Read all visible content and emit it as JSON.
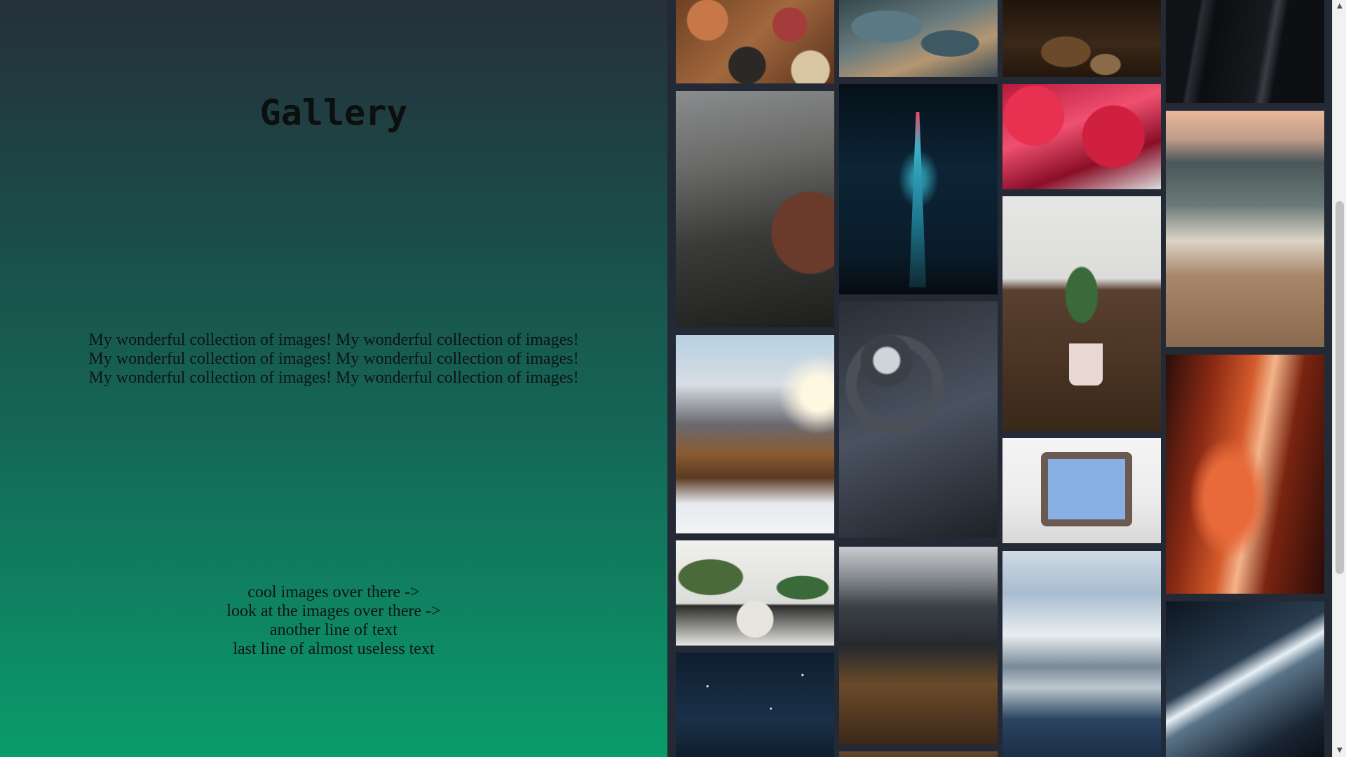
{
  "left_panel": {
    "title": "Gallery",
    "intro_lines": [
      "My wonderful collection of images! My wonderful collection of images!",
      "My wonderful collection of images! My wonderful collection of images!",
      "My wonderful collection of images! My wonderful collection of images!"
    ],
    "bottom_lines": [
      "cool images over there ->",
      "look at the images over there ->",
      "another line of text",
      "last line of almost useless text"
    ]
  },
  "gallery": {
    "columns": [
      [
        {
          "name": "food-table-photo",
          "style": "t-food"
        },
        {
          "name": "rainy-city-street-photo",
          "style": "t-rain"
        },
        {
          "name": "snowy-mountain-forest-photo",
          "style": "t-mountain"
        },
        {
          "name": "cactus-pots-photo",
          "style": "t-cactuspots"
        },
        {
          "name": "starry-sky-photo",
          "style": "t-stars"
        }
      ],
      [
        {
          "name": "aerial-coast-photo",
          "style": "t-aerial"
        },
        {
          "name": "lit-tower-night-photo",
          "style": "t-tower"
        },
        {
          "name": "spiral-staircase-photo",
          "style": "t-spiral"
        },
        {
          "name": "pier-stairs-sea-photo",
          "style": "t-pier"
        },
        {
          "name": "partial-photo",
          "style": "t-strip"
        }
      ],
      [
        {
          "name": "autumn-leaves-photo",
          "style": "t-leaves"
        },
        {
          "name": "red-tree-photo",
          "style": "t-redtree"
        },
        {
          "name": "potted-cactus-photo",
          "style": "t-cactus"
        },
        {
          "name": "retro-tv-photo",
          "style": "t-tv"
        },
        {
          "name": "mountain-lake-photo",
          "style": "t-lake"
        }
      ],
      [
        {
          "name": "escalator-photo",
          "style": "t-escalator"
        },
        {
          "name": "ocean-beach-photo",
          "style": "t-ocean"
        },
        {
          "name": "red-canyon-photo",
          "style": "t-canyon"
        },
        {
          "name": "tunnel-lights-photo",
          "style": "t-tunnel"
        }
      ]
    ]
  },
  "scrollbar": {
    "up_arrow_icon": "triangle-up",
    "down_arrow_icon": "triangle-down"
  }
}
